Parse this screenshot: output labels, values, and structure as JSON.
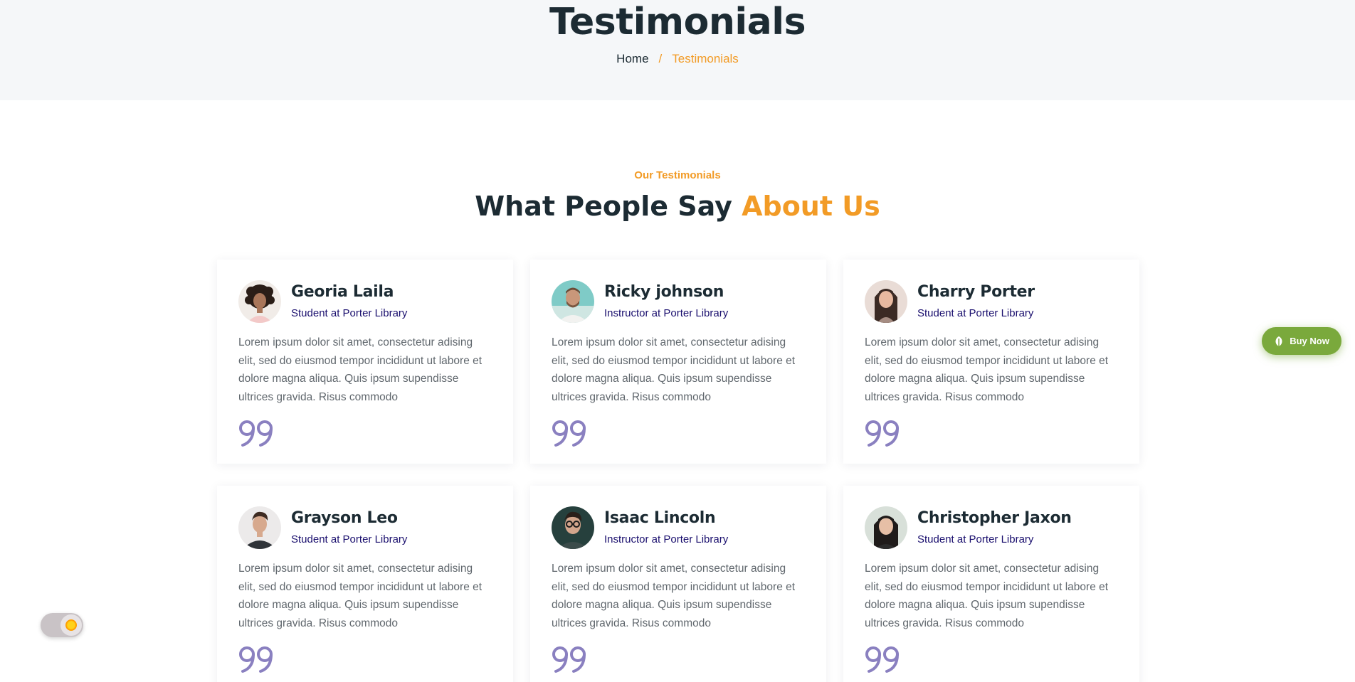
{
  "hero": {
    "title": "Testimonials",
    "breadcrumb": {
      "home": "Home",
      "separator": "/",
      "current": "Testimonials"
    }
  },
  "section": {
    "tag": "Our Testimonials",
    "title_main": "What People Say ",
    "title_highlight": "About Us"
  },
  "testimonials": [
    {
      "name": "Georia Laila",
      "role": "Student at Porter Library",
      "text": "Lorem ipsum dolor sit amet, consectetur adising elit, sed do eiusmod tempor incididunt ut labore et dolore magna aliqua. Quis ipsum supendisse ultrices gravida. Risus commodo",
      "avatar": "avatar-woman-curly-hair"
    },
    {
      "name": "Ricky johnson",
      "role": "Instructor at Porter Library",
      "text": "Lorem ipsum dolor sit amet, consectetur adising elit, sed do eiusmod tempor incididunt ut labore et dolore magna aliqua. Quis ipsum supendisse ultrices gravida. Risus commodo",
      "avatar": "avatar-man-beard"
    },
    {
      "name": "Charry Porter",
      "role": "Student at Porter Library",
      "text": "Lorem ipsum dolor sit amet, consectetur adising elit, sed do eiusmod tempor incididunt ut labore et dolore magna aliqua. Quis ipsum supendisse ultrices gravida. Risus commodo",
      "avatar": "avatar-woman-long-hair"
    },
    {
      "name": "Grayson Leo",
      "role": "Student at Porter Library",
      "text": "Lorem ipsum dolor sit amet, consectetur adising elit, sed do eiusmod tempor incididunt ut labore et dolore magna aliqua. Quis ipsum supendisse ultrices gravida. Risus commodo",
      "avatar": "avatar-man-dark-shirt"
    },
    {
      "name": "Isaac Lincoln",
      "role": "Instructor at Porter Library",
      "text": "Lorem ipsum dolor sit amet, consectetur adising elit, sed do eiusmod tempor incididunt ut labore et dolore magna aliqua. Quis ipsum supendisse ultrices gravida. Risus commodo",
      "avatar": "avatar-man-glasses"
    },
    {
      "name": "Christopher Jaxon",
      "role": "Student at Porter Library",
      "text": "Lorem ipsum dolor sit amet, consectetur adising elit, sed do eiusmod tempor incididunt ut labore et dolore magna aliqua. Quis ipsum supendisse ultrices gravida. Risus commodo",
      "avatar": "avatar-woman-dark-hair"
    }
  ],
  "quote_icon": "quote-icon",
  "buy_now": {
    "label": "Buy Now",
    "icon": "leaf-icon"
  },
  "theme_toggle": {
    "icon": "sun-icon"
  },
  "colors": {
    "accent": "#f29b26",
    "heading": "#1c2b33",
    "role": "#1a0f6e",
    "body_text": "#60676d",
    "quote": "#8a80c0",
    "buy_now": "#7aa93c",
    "hero_bg": "#f5f7f9"
  }
}
